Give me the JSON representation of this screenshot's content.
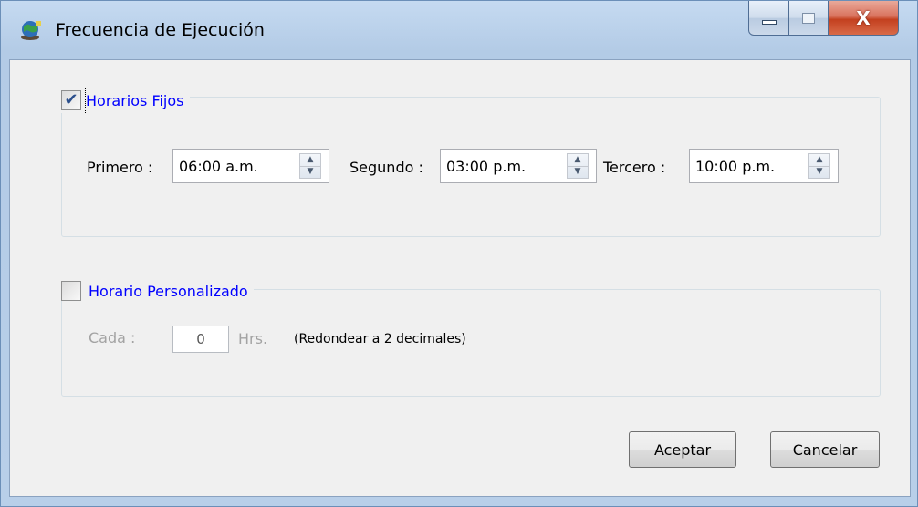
{
  "window": {
    "title": "Frecuencia de Ejecución",
    "icon": "globe-app-icon",
    "controls": {
      "minimize": "minimize-icon",
      "maximize": "maximize-icon",
      "close": "X"
    }
  },
  "fixed_schedule": {
    "label": "Horarios Fijos",
    "checked": true,
    "first": {
      "label": "Primero :",
      "value": "06:00 a.m."
    },
    "second": {
      "label": "Segundo :",
      "value": "03:00 p.m."
    },
    "third": {
      "label": "Tercero :",
      "value": "10:00 p.m."
    }
  },
  "custom_schedule": {
    "label": "Horario Personalizado",
    "checked": false,
    "every_label": "Cada :",
    "every_value": "0",
    "unit": "Hrs.",
    "note": "(Redondear a 2 decimales)"
  },
  "buttons": {
    "accept": "Aceptar",
    "cancel": "Cancelar"
  },
  "colors": {
    "legend_text": "#0000ff",
    "disabled_text": "#a3a3a3",
    "client_bg": "#f0f0f0"
  }
}
